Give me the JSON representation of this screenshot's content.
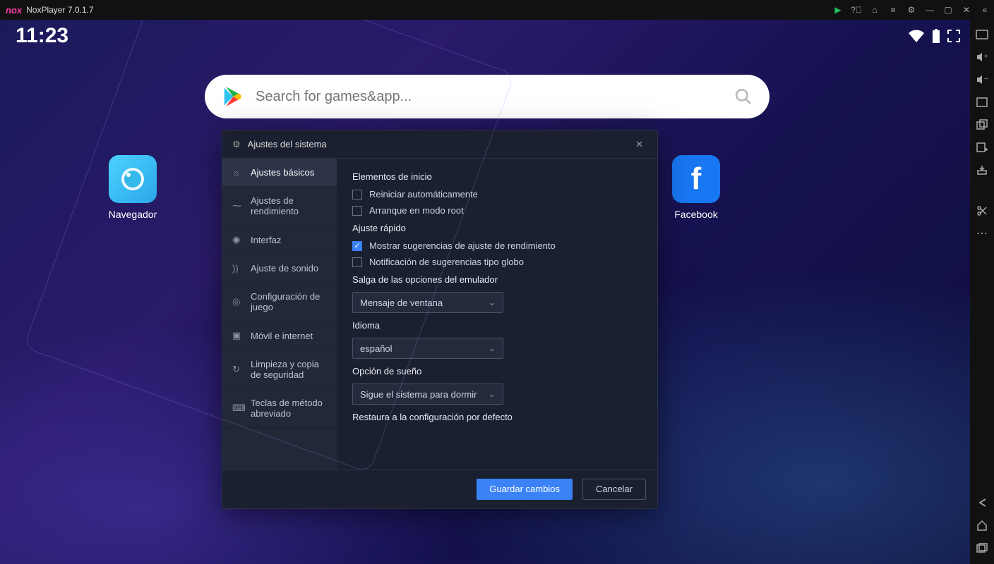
{
  "titlebar": {
    "app_name": "NoxPlayer 7.0.1.7"
  },
  "status": {
    "clock": "11:23"
  },
  "search": {
    "placeholder": "Search for games&app..."
  },
  "apps": {
    "navegador": "Navegador",
    "facebook": "Facebook"
  },
  "dialog": {
    "title": "Ajustes del sistema",
    "nav": {
      "basic": "Ajustes básicos",
      "perf": "Ajustes de rendimiento",
      "interface": "Interfaz",
      "sound": "Ajuste de sonido",
      "game": "Configuración de juego",
      "mobile": "Móvil e internet",
      "cleanup": "Limpieza y copia de seguridad",
      "shortcut": "Teclas de método abreviado"
    },
    "sections": {
      "startup": "Elementos de inicio",
      "quick": "Ajuste rápido",
      "exit": "Salga de las opciones del emulador",
      "lang": "Idioma",
      "sleep": "Opción de sueño",
      "restore": "Restaura a la configuración por defecto"
    },
    "checks": {
      "restart": "Reiniciar automáticamente",
      "root": "Arranque en modo root",
      "suggest": "Mostrar sugerencias de ajuste de rendimiento",
      "balloon": "Notificación de sugerencias tipo globo"
    },
    "selects": {
      "exit_value": "Mensaje de ventana",
      "lang_value": "español",
      "sleep_value": "Sigue el sistema para dormir"
    },
    "buttons": {
      "save": "Guardar cambios",
      "cancel": "Cancelar"
    }
  }
}
